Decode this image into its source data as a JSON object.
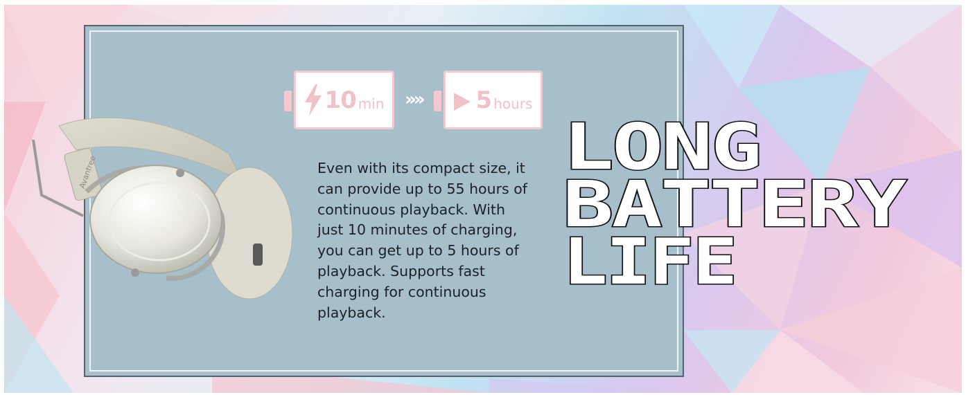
{
  "badges": {
    "charge": {
      "value": "10",
      "unit": "min"
    },
    "separator": "»»",
    "play": {
      "value": "5",
      "unit": "hours"
    }
  },
  "description": "Even with its compact size, it can provide up to 55 hours of continuous playback. With just 10 minutes of charging, you can get up to 5 hours of playback. Supports fast charging for continuous playback.",
  "headline": {
    "line1": "LONG",
    "line2": "BATTERY",
    "line3": "LIFE"
  },
  "product": {
    "brand_mark": "Avantree"
  },
  "colors": {
    "panel": "#a6bfcb",
    "badge_accent": "#f3c8ce",
    "headline_fill": "#ffffff",
    "headline_outline": "#111111"
  },
  "icons": {
    "charge": "lightning-bolt-icon",
    "play": "play-triangle-icon",
    "separator": "triple-chevron-right-icon"
  }
}
